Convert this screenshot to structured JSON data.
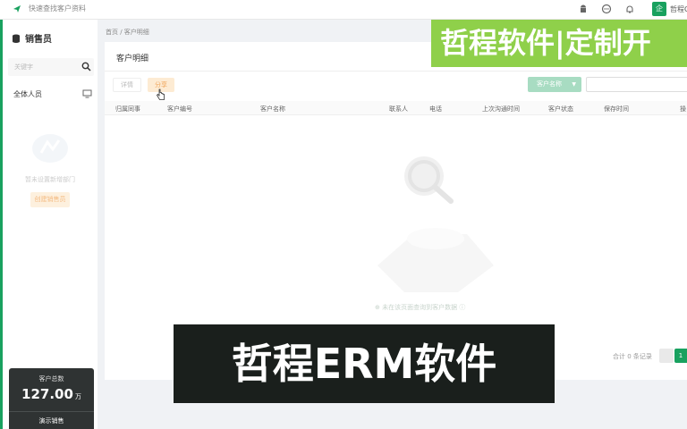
{
  "topbar": {
    "app_title": "快速查找客户资料",
    "user_badge": "企",
    "user_name": "哲程C"
  },
  "sidebar": {
    "title": "销售员",
    "search_placeholder": "关键字",
    "all_people": "全体人员",
    "empty_text": "暂未设置新增部门",
    "create_button": "创建销售员"
  },
  "stats": {
    "label": "客户总数",
    "value": "127.00",
    "unit": "万",
    "demo_button": "演示销售"
  },
  "breadcrumb": "首页 / 客户明细",
  "panel": {
    "title": "客户明细",
    "detail_button": "详情",
    "share_button": "分享",
    "filter_select": "客户名称",
    "columns": [
      "归属同事",
      "客户编号",
      "客户名称",
      "联系人",
      "电话",
      "上次沟通时间",
      "客户状态",
      "保存时间",
      "操"
    ],
    "empty_message": "未在该页面查询到客户数据",
    "pager_total": "合计 0 条记录",
    "pager_page": "1"
  },
  "watermarks": {
    "top": "哲程软件|定制开",
    "bottom": "哲程ERM软件"
  },
  "colors": {
    "brand_green": "#19a15f",
    "accent_orange": "#f0a55a",
    "watermark_green": "#8fd04a"
  }
}
